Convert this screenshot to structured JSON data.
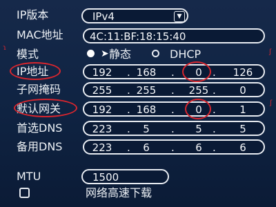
{
  "ip_version": {
    "label": "IP版本",
    "value": "IPv4"
  },
  "mac": {
    "label": "MAC地址",
    "value": "4C:11:BF:18:15:40"
  },
  "mode": {
    "label": "模式",
    "options": [
      "静态",
      "DHCP"
    ],
    "selected": "静态"
  },
  "ip_address": {
    "label": "IP地址",
    "octets": [
      "192",
      "168",
      "0",
      "126"
    ]
  },
  "subnet_mask": {
    "label": "子网掩码",
    "octets": [
      "255",
      "255",
      "255",
      "0"
    ]
  },
  "gateway": {
    "label": "默认网关",
    "octets": [
      "192",
      "168",
      "0",
      "1"
    ]
  },
  "dns1": {
    "label": "首选DNS",
    "octets": [
      "223",
      "5",
      "5",
      "5"
    ]
  },
  "dns2": {
    "label": "备用DNS",
    "octets": [
      "223",
      "6",
      "6",
      "6"
    ]
  },
  "mtu": {
    "label": "MTU",
    "value": "1500"
  },
  "fast_download": {
    "label": "网络高速下载",
    "checked": false
  },
  "colors": {
    "annotation": "#d8262e",
    "field_border": "#e8ecf2",
    "background": "#0f2342"
  }
}
